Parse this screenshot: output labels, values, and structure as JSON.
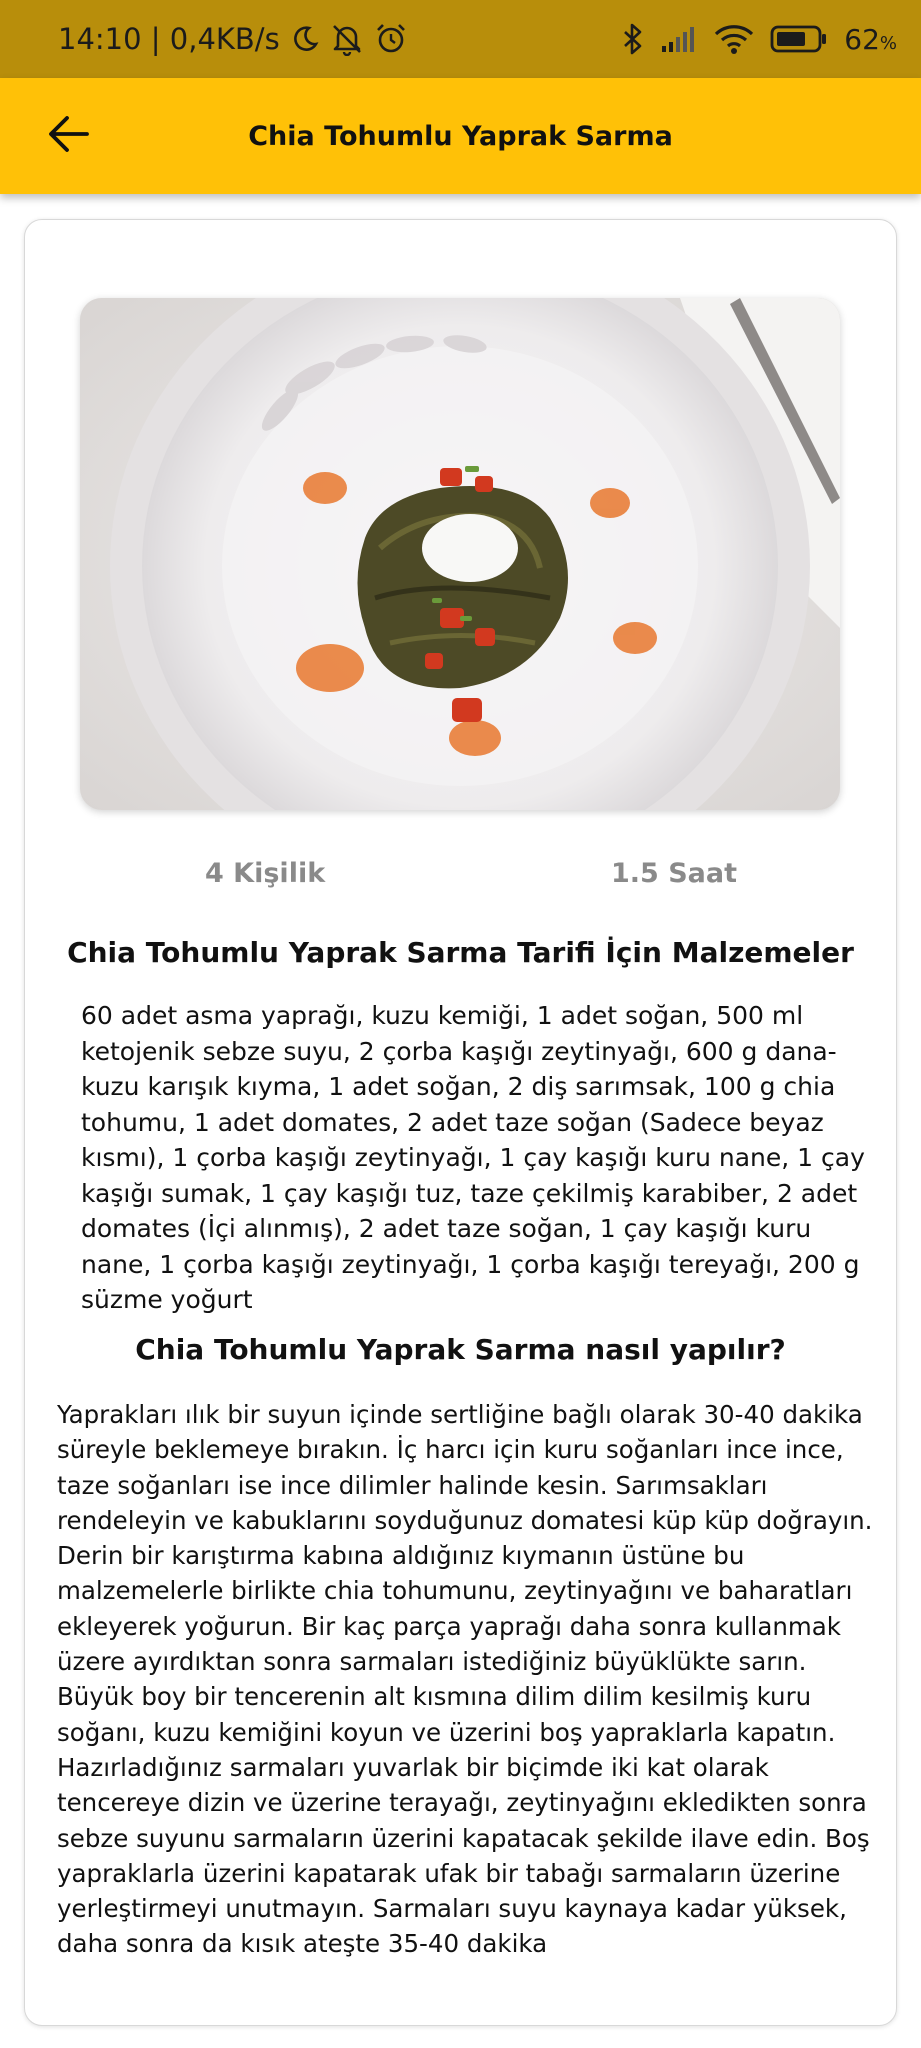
{
  "status_bar": {
    "time_speed": "14:10 | 0,4KB/s",
    "battery_percent": "62",
    "battery_unit": "%",
    "icons": [
      "moon-icon",
      "muted-bell-icon",
      "alarm-icon",
      "bluetooth-icon",
      "signal-icon",
      "wifi-icon",
      "battery-icon"
    ]
  },
  "app_bar": {
    "title": "Chia Tohumlu Yaprak Sarma",
    "back_icon": "arrow-left-icon",
    "color": "#FFC107"
  },
  "recipe": {
    "image_description_icon": "recipe-photo",
    "servings": "4 Kişilik",
    "duration": "1.5 Saat",
    "ingredients_heading": "Chia Tohumlu Yaprak Sarma Tarifi İçin Malzemeler",
    "ingredients": "60 adet asma yaprağı, kuzu kemiği, 1 adet soğan, 500 ml ketojenik sebze suyu, 2 çorba kaşığı zeytinyağı, 600 g dana-kuzu karışık kıyma, 1 adet soğan, 2 diş sarımsak, 100 g chia tohumu, 1 adet domates, 2 adet taze soğan (Sadece beyaz kısmı), 1 çorba kaşığı zeytinyağı, 1 çay kaşığı kuru nane, 1 çay kaşığı sumak, 1 çay kaşığı tuz, taze çekilmiş karabiber, 2 adet domates (İçi alınmış), 2 adet taze soğan, 1 çay kaşığı kuru nane, 1 çorba kaşığı zeytinyağı, 1 çorba kaşığı tereyağı, 200 g süzme yoğurt",
    "method_heading": "Chia Tohumlu Yaprak Sarma nasıl yapılır?",
    "method": "Yaprakları ılık bir suyun içinde sertliğine bağlı olarak 30-40 dakika süreyle beklemeye bırakın. İç harcı için kuru soğanları ince ince,  taze soğanları ise ince dilimler halinde kesin. Sarımsakları rendeleyin ve kabuklarını soyduğunuz  domatesi küp küp doğrayın. Derin bir karıştırma kabına aldığınız kıymanın üstüne bu malzemelerle birlikte chia tohumunu, zeytinyağını ve baharatları ekleyerek yoğurun. Bir kaç parça yaprağı daha sonra kullanmak üzere ayırdıktan sonra sarmaları istediğiniz büyüklükte sarın. Büyük boy bir tencerenin alt kısmına dilim dilim kesilmiş kuru soğanı, kuzu kemiğini koyun ve üzerini boş yapraklarla kapatın. Hazırladığınız sarmaları yuvarlak bir biçimde iki kat olarak tencereye dizin ve üzerine terayağı, zeytinyağını ekledikten sonra sebze suyunu sarmaların üzerini kapatacak şekilde ilave edin. Boş yapraklarla üzerini kapatarak  ufak bir tabağı sarmaların üzerine yerleştirmeyi unutmayın. Sarmaları suyu kaynaya kadar yüksek, daha sonra da kısık ateşte 35-40 dakika"
  }
}
